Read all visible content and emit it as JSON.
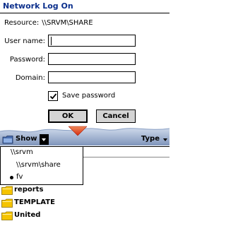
{
  "dialog": {
    "title": "Network Log On",
    "resource_label": "Resource:",
    "resource_value": "\\\\SRVM\\SHARE",
    "user_name_label": "User name:",
    "user_name_value": "",
    "password_label": "Password:",
    "password_value": "",
    "domain_label": "Domain:",
    "domain_value": "",
    "save_password_label": "Save password",
    "save_password_checked": true,
    "ok_label": "OK",
    "cancel_label": "Cancel"
  },
  "explorer": {
    "show_label": "Show",
    "type_label": "Type",
    "path_menu": [
      "\\\\srvm",
      "\\\\srvm\\share",
      "fv"
    ],
    "path_menu_selected": "fv",
    "folders": [
      "reports",
      "TEMPLATE",
      "United"
    ],
    "folder_color": "#f5c400",
    "accent_arrow_color": "#e03a1e"
  }
}
